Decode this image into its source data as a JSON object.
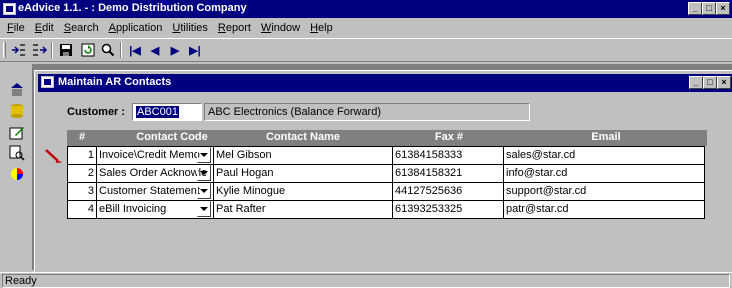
{
  "app": {
    "title": "eAdvice 1.1. - : Demo Distribution Company",
    "window_buttons": [
      "_",
      "□",
      "×"
    ]
  },
  "menu": [
    {
      "underline": "F",
      "rest": "ile"
    },
    {
      "underline": "E",
      "rest": "dit"
    },
    {
      "underline": "S",
      "rest": "earch"
    },
    {
      "underline": "A",
      "rest": "pplication"
    },
    {
      "underline": "U",
      "rest": "tilities"
    },
    {
      "underline": "R",
      "rest": "eport"
    },
    {
      "underline": "W",
      "rest": "indow"
    },
    {
      "underline": "H",
      "rest": "elp"
    }
  ],
  "toolbar": {
    "first": "|◀",
    "prev": "◀",
    "next": "▶",
    "last": "▶|"
  },
  "child": {
    "title": "Maintain AR Contacts",
    "customer_label": "Customer :",
    "customer_code": "ABC001",
    "customer_name": "ABC Electronics (Balance Forward)"
  },
  "grid": {
    "headers": [
      "#",
      "Contact Code",
      "Contact Name",
      "Fax #",
      "Email"
    ],
    "rows": [
      {
        "num": "1",
        "code": "Invoice\\Credit Memo",
        "name": "Mel Gibson",
        "fax": "61384158333",
        "email": "sales@star.cd"
      },
      {
        "num": "2",
        "code": "Sales Order Acknowle",
        "name": "Paul Hogan",
        "fax": "61384158321",
        "email": "info@star.cd"
      },
      {
        "num": "3",
        "code": "Customer Statement",
        "name": "Kylie Minogue",
        "fax": "44127525636",
        "email": "support@star.cd"
      },
      {
        "num": "4",
        "code": "eBill Invoicing",
        "name": "Pat Rafter",
        "fax": "61393253325",
        "email": "patr@star.cd"
      }
    ]
  },
  "status": {
    "text": "Ready"
  }
}
